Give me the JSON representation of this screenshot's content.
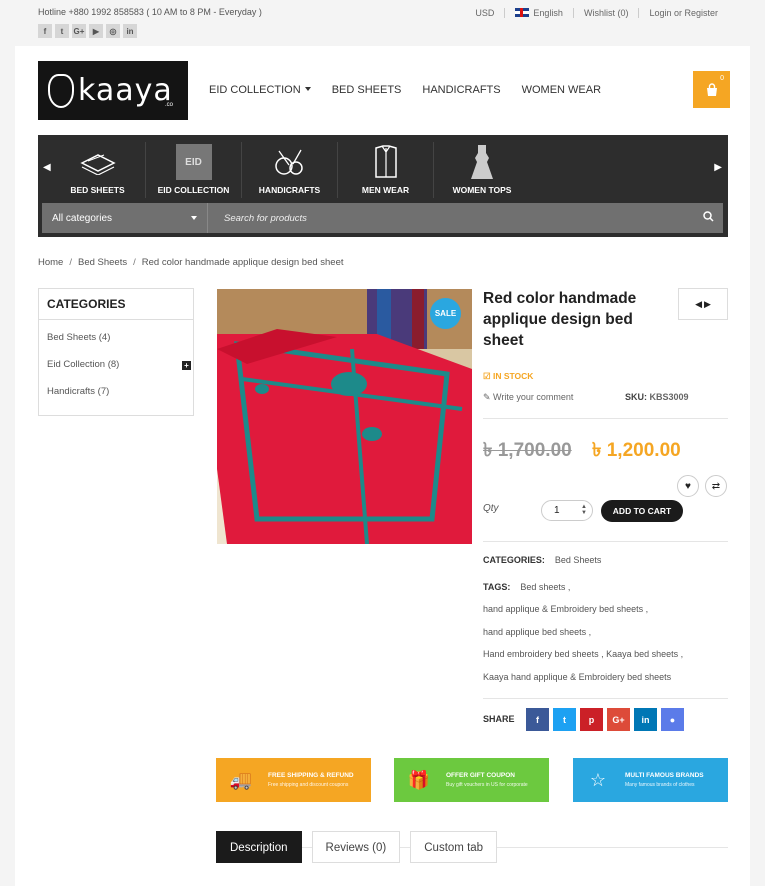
{
  "topbar": {
    "hotline": "Hotline +880 1992 858583 ( 10 AM to 8 PM - Everyday )",
    "social": [
      "f",
      "t",
      "G+",
      "▶",
      "◎",
      "in"
    ],
    "currency": "USD",
    "language": "English",
    "wishlist": "Wishlist (0)",
    "login": "Login or Register"
  },
  "logo": {
    "name": "kaaya",
    "suffix": ".co"
  },
  "nav": {
    "eid": "EID COLLECTION",
    "bed": "BED SHEETS",
    "handicrafts": "HANDICRAFTS",
    "women": "WOMEN WEAR"
  },
  "cart": {
    "count": "0"
  },
  "categories_bar": {
    "items": [
      "BED SHEETS",
      "EID COLLECTION",
      "HANDICRAFTS",
      "MEN WEAR",
      "WOMEN TOPS"
    ],
    "eid_icon_text": "EID"
  },
  "search": {
    "category": "All categories",
    "placeholder": "Search for products"
  },
  "breadcrumb": {
    "home": "Home",
    "bed": "Bed Sheets",
    "current": "Red color handmade applique design bed sheet"
  },
  "sidebar": {
    "title": "CATEGORIES",
    "items": [
      "Bed Sheets (4)",
      "Eid Collection (8)",
      "Handicrafts (7)"
    ]
  },
  "product": {
    "sale": "SALE",
    "title": "Red color handmade applique design bed sheet",
    "stock": "IN STOCK",
    "comment": "Write your comment",
    "sku_label": "SKU:",
    "sku": "KBS3009",
    "old_price": "৳ 1,700.00",
    "new_price": "৳ 1,200.00",
    "qty_label": "Qty",
    "qty": "1",
    "add_to_cart": "ADD TO CART",
    "categories_label": "CATEGORIES:",
    "category": "Bed Sheets",
    "tags_label": "TAGS:",
    "tags": [
      "Bed sheets ,",
      "hand applique & Embroidery bed sheets ,",
      "hand applique bed sheets ,",
      "Hand embroidery bed sheets , Kaaya bed sheets ,",
      "Kaaya hand applique & Embroidery bed sheets"
    ],
    "share_label": "SHARE"
  },
  "colors": {
    "accent": "#f5a623",
    "sale": "#2aa7e0",
    "dark": "#1b1b1b"
  },
  "promos": [
    {
      "title": "FREE SHIPPING & REFUND",
      "sub": "Free shipping and discount coupons",
      "color": "#f5a623"
    },
    {
      "title": "OFFER GIFT COUPON",
      "sub": "Buy gift vouchers in US for corporate",
      "color": "#6cc93f"
    },
    {
      "title": "MULTI FAMOUS BRANDS",
      "sub": "Many famous brands of clothes",
      "color": "#2aa7e0"
    }
  ],
  "tabs": [
    "Description",
    "Reviews (0)",
    "Custom tab"
  ]
}
